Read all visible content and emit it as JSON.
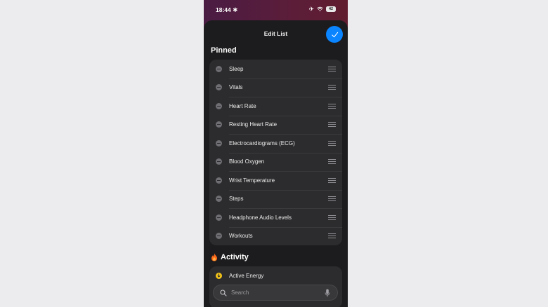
{
  "status_bar": {
    "time": "18:44",
    "focus_icon": "asterisk-icon",
    "battery": "42"
  },
  "sheet": {
    "title": "Edit List",
    "done_icon": "checkmark-icon"
  },
  "pinned": {
    "heading": "Pinned",
    "items": [
      {
        "label": "Sleep"
      },
      {
        "label": "Vitals"
      },
      {
        "label": "Heart Rate"
      },
      {
        "label": "Resting Heart Rate"
      },
      {
        "label": "Electrocardiograms (ECG)"
      },
      {
        "label": "Blood Oxygen"
      },
      {
        "label": "Wrist Temperature"
      },
      {
        "label": "Steps"
      },
      {
        "label": "Headphone Audio Levels"
      },
      {
        "label": "Workouts"
      }
    ]
  },
  "activity": {
    "heading": "Activity",
    "icon": "flame-icon",
    "items": [
      {
        "label": "Active Energy"
      }
    ]
  },
  "search": {
    "placeholder": "Search"
  },
  "colors": {
    "accent": "#0a84ff",
    "flame": "#ff6b1a",
    "energy": "#f5c518",
    "background": "#1c1c1e"
  }
}
